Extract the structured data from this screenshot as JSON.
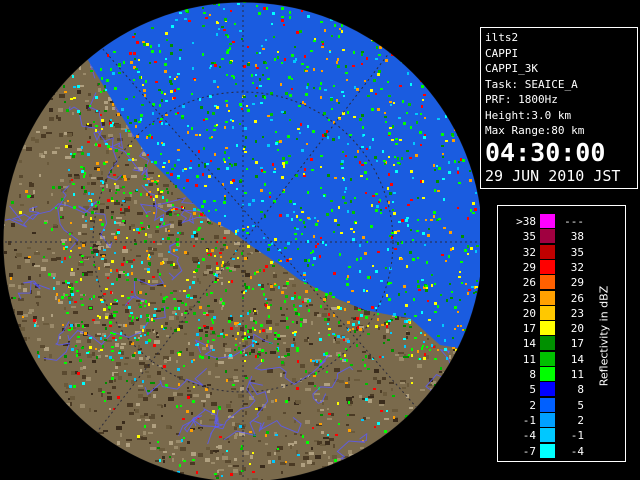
{
  "info": {
    "site": "ilts2",
    "product": "CAPPI",
    "product_id": "CAPPI_3K",
    "task": "Task: SEAICE_A",
    "prf": "PRF: 1800Hz",
    "height": "Height:3.0 km",
    "max_range": "Max Range:80 km",
    "time": "04:30:00",
    "date": "29 JUN 2010 JST"
  },
  "legend": {
    "title": "Reflectivity in dBZ",
    "bins": [
      {
        "lo": ">38",
        "hi": "---",
        "color": "#ff00ff"
      },
      {
        "lo": "35",
        "hi": "38",
        "color": "#a00040"
      },
      {
        "lo": "32",
        "hi": "35",
        "color": "#c00000"
      },
      {
        "lo": "29",
        "hi": "32",
        "color": "#ff0000"
      },
      {
        "lo": "26",
        "hi": "29",
        "color": "#ff6000"
      },
      {
        "lo": "23",
        "hi": "26",
        "color": "#ffa000"
      },
      {
        "lo": "20",
        "hi": "23",
        "color": "#ffc800"
      },
      {
        "lo": "17",
        "hi": "20",
        "color": "#ffff00"
      },
      {
        "lo": "14",
        "hi": "17",
        "color": "#009000"
      },
      {
        "lo": "11",
        "hi": "14",
        "color": "#00c000"
      },
      {
        "lo": "8",
        "hi": "11",
        "color": "#00ff00"
      },
      {
        "lo": "5",
        "hi": "8",
        "color": "#0000ff"
      },
      {
        "lo": "2",
        "hi": "5",
        "color": "#0060ff"
      },
      {
        "lo": "-1",
        "hi": "2",
        "color": "#00a0ff"
      },
      {
        "lo": "-4",
        "hi": "-1",
        "color": "#00c8ff"
      },
      {
        "lo": "-7",
        "hi": "-4",
        "color": "#00ffff"
      }
    ]
  },
  "map_colors": {
    "sea": "#1a5ce0",
    "land_light": "#8a7a5a",
    "land_dark": "#3a2a1a",
    "rivers": "#5a5aff",
    "grid": "#333333"
  }
}
